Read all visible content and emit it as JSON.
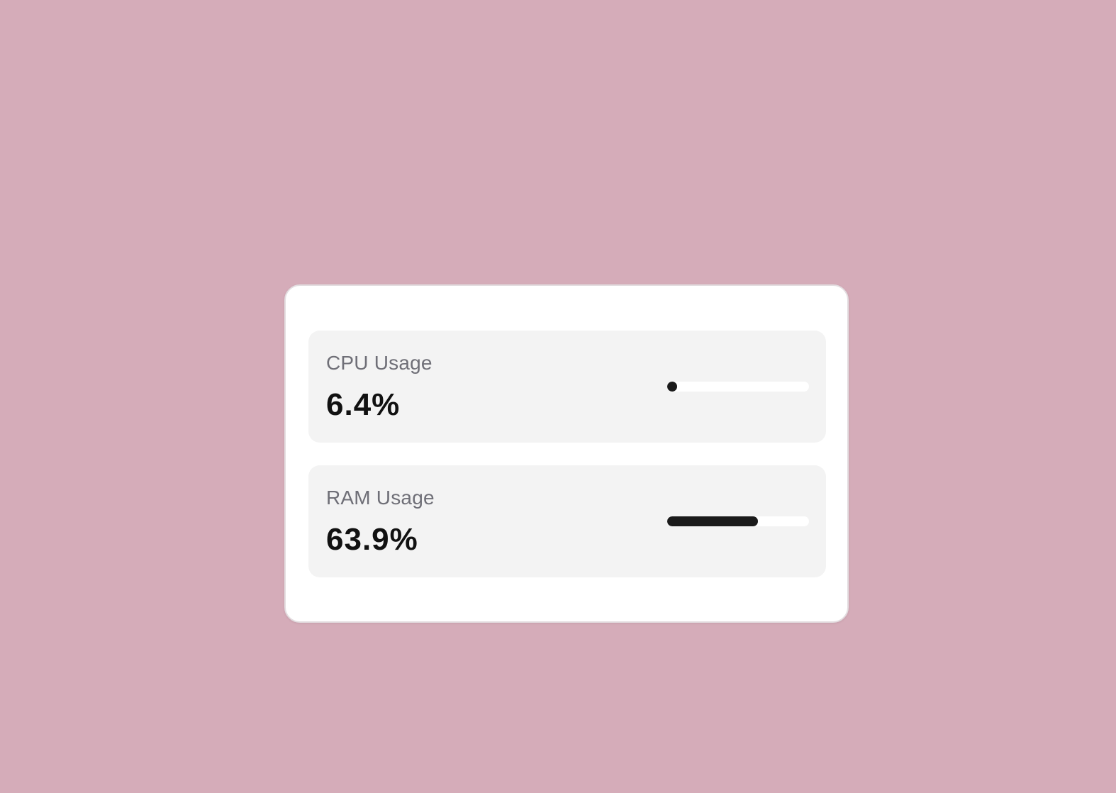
{
  "metrics": {
    "cpu": {
      "label": "CPU Usage",
      "value_text": "6.4%",
      "percent": 6.4
    },
    "ram": {
      "label": "RAM Usage",
      "value_text": "63.9%",
      "percent": 63.9
    }
  },
  "colors": {
    "background": "#d5acb9",
    "card": "#ffffff",
    "tile": "#f3f3f3",
    "bar_fill": "#1a1a1a",
    "bar_track": "#ffffff",
    "label": "#6f6f77",
    "value": "#111111"
  }
}
